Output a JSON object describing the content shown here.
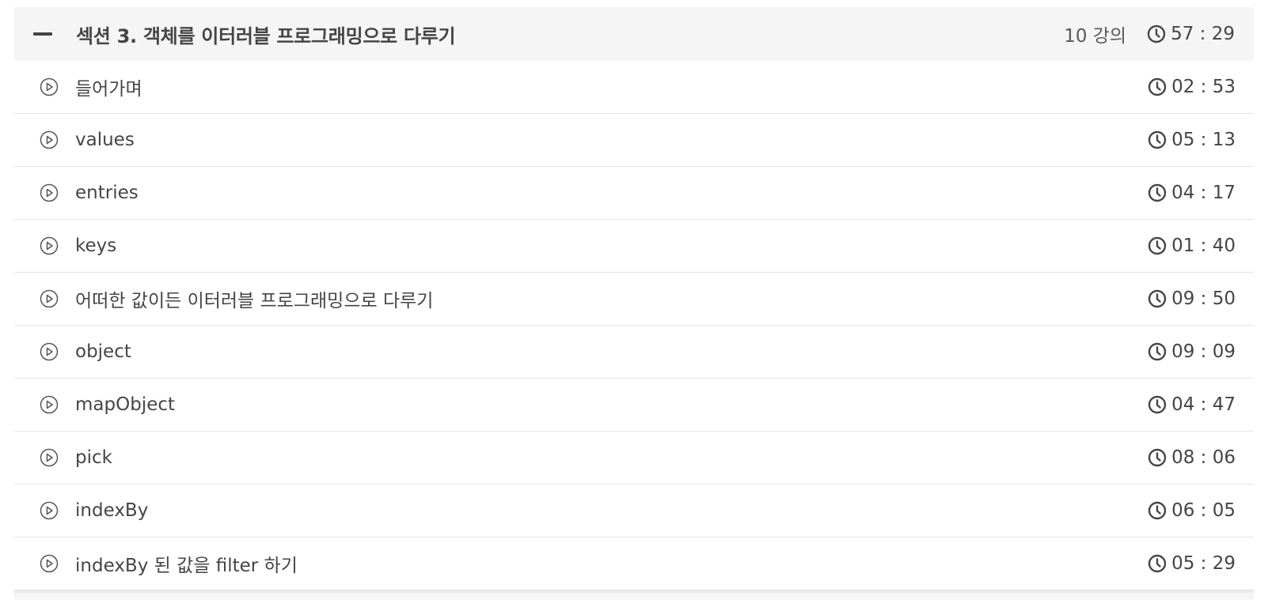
{
  "section": {
    "title": "섹션 3. 객체를 이터러블 프로그래밍으로 다루기",
    "count": "10 강의",
    "duration": "57 : 29",
    "collapse_icon": "minus-icon",
    "clock_icon": "clock-icon"
  },
  "lectures": [
    {
      "title": "들어가며",
      "duration": "02 : 53"
    },
    {
      "title": "values",
      "duration": "05 : 13"
    },
    {
      "title": "entries",
      "duration": "04 : 17"
    },
    {
      "title": "keys",
      "duration": "01 : 40"
    },
    {
      "title": "어떠한 값이든 이터러블 프로그래밍으로 다루기",
      "duration": "09 : 50"
    },
    {
      "title": "object",
      "duration": "09 : 09"
    },
    {
      "title": "mapObject",
      "duration": "04 : 47"
    },
    {
      "title": "pick",
      "duration": "08 : 06"
    },
    {
      "title": "indexBy",
      "duration": "06 : 05"
    },
    {
      "title": "indexBy 된 값을 filter 하기",
      "duration": "05 : 29"
    }
  ],
  "colors": {
    "text": "#454545",
    "header_bg": "#f5f5f5",
    "divider": "#e4e4e4"
  }
}
